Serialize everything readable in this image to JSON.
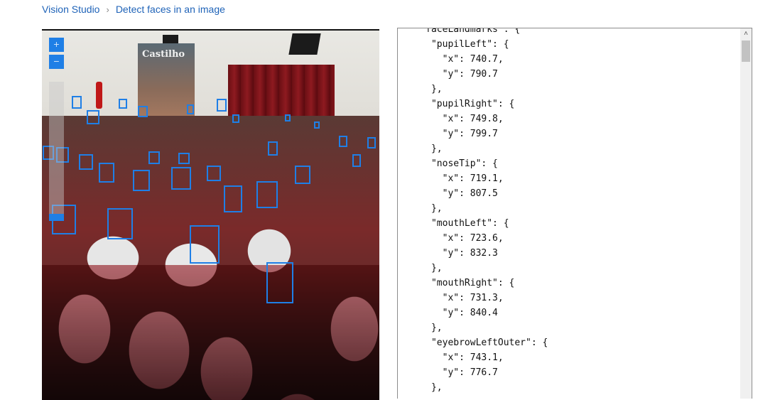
{
  "breadcrumb": {
    "root": "Vision Studio",
    "separator": "›",
    "current": "Detect faces in an image"
  },
  "image_viewer": {
    "zoom_in": "+",
    "zoom_out": "−",
    "poster_text": "Castilho",
    "accent_color": "#1f7fe6",
    "detected_faces_visible": 29
  },
  "json_output": {
    "lines": [
      "    \"faceLandmarks\": {",
      "      \"pupilLeft\": {",
      "        \"x\": 740.7,",
      "        \"y\": 790.7",
      "      },",
      "      \"pupilRight\": {",
      "        \"x\": 749.8,",
      "        \"y\": 799.7",
      "      },",
      "      \"noseTip\": {",
      "        \"x\": 719.1,",
      "        \"y\": 807.5",
      "      },",
      "      \"mouthLeft\": {",
      "        \"x\": 723.6,",
      "        \"y\": 832.3",
      "      },",
      "      \"mouthRight\": {",
      "        \"x\": 731.3,",
      "        \"y\": 840.4",
      "      },",
      "      \"eyebrowLeftOuter\": {",
      "        \"x\": 743.1,",
      "        \"y\": 776.7",
      "      },"
    ],
    "scroll_up_icon": "chevron-up-icon"
  }
}
